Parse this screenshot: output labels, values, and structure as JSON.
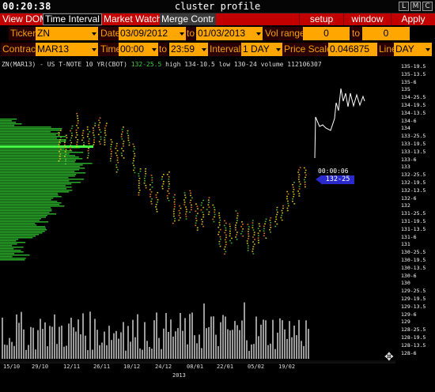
{
  "titlebar": {
    "clock": "00:20:38",
    "title": "cluster profile",
    "buttons": [
      "L",
      "M",
      "C"
    ]
  },
  "menu": {
    "items": [
      "View DOM",
      "Time Interval",
      "Market Watch",
      "Merge Contr"
    ],
    "right": [
      "setup",
      "window",
      "Apply"
    ]
  },
  "row1": {
    "ticker_label": "Ticker",
    "ticker_value": "ZN",
    "date_label": "Date",
    "date_from": "03/09/2012",
    "date_to_label": "to",
    "date_to": "01/03/2013",
    "vol_label": "Vol range",
    "vol_from": "0",
    "vol_to_label": "to",
    "vol_to": "0"
  },
  "row2": {
    "contract_label": "Contract",
    "contract_value": "MAR13",
    "time_label": "Time",
    "time_from": "00:00",
    "time_to_label": "to",
    "time_to": "23:59",
    "interval_label": "Interval",
    "interval_value": "1 DAY",
    "pricescale_label": "Price Scale",
    "pricescale_value": "0.046875",
    "line_label": "Line",
    "line_value": "DAY"
  },
  "chart_info": {
    "symbol": "ZN(MAR13) - US T-NOTE 10 YR(CBOT)",
    "change": "132-25.5",
    "high": "high 134-10.5",
    "low": "low 130-24",
    "volume": "volume 112106307"
  },
  "price_axis": [
    "135-19.5",
    "135-13.5",
    "135-6",
    "135",
    "134-25.5",
    "134-19.5",
    "134-13.5",
    "134-6",
    "134",
    "133-25.5",
    "133-19.5",
    "133-13.5",
    "133-6",
    "133",
    "132-25.5",
    "132-19.5",
    "132-13.5",
    "132-6",
    "132",
    "131-25.5",
    "131-19.5",
    "131-13.5",
    "131-6",
    "131",
    "130-25.5",
    "130-19.5",
    "130-13.5",
    "130-6",
    "130",
    "129-25.5",
    "129-19.5",
    "129-13.5",
    "129-6",
    "129",
    "128-25.5",
    "128-19.5",
    "128-13.5",
    "128-6"
  ],
  "date_axis": [
    "15/10",
    "29/10",
    "12/11",
    "26/11",
    "10/12",
    "24/12",
    "08/01",
    "22/01",
    "05/02",
    "19/02"
  ],
  "year_label": "2013",
  "timer": "00:00:06",
  "current_price": "132-25",
  "colors": {
    "menu_red": "#c30000",
    "field_orange": "#ffa600",
    "label_orange": "#f5a000",
    "profile_green": "#33cc33",
    "price_blue": "#2a2acc"
  },
  "icons": {
    "move_cursor": "move-cursor-icon"
  }
}
